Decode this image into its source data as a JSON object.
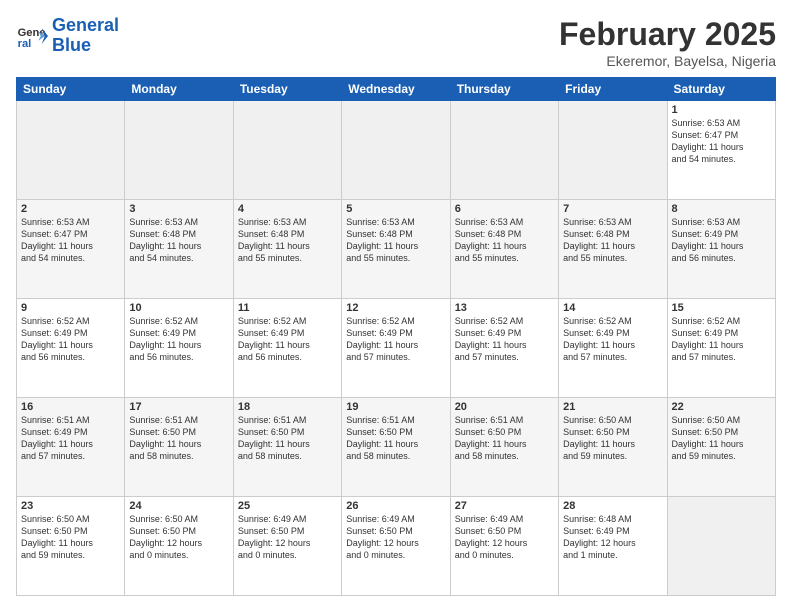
{
  "header": {
    "logo_line1": "General",
    "logo_line2": "Blue",
    "title": "February 2025",
    "subtitle": "Ekeremor, Bayelsa, Nigeria"
  },
  "calendar": {
    "days_of_week": [
      "Sunday",
      "Monday",
      "Tuesday",
      "Wednesday",
      "Thursday",
      "Friday",
      "Saturday"
    ],
    "weeks": [
      [
        {
          "day": "",
          "info": ""
        },
        {
          "day": "",
          "info": ""
        },
        {
          "day": "",
          "info": ""
        },
        {
          "day": "",
          "info": ""
        },
        {
          "day": "",
          "info": ""
        },
        {
          "day": "",
          "info": ""
        },
        {
          "day": "1",
          "info": "Sunrise: 6:53 AM\nSunset: 6:47 PM\nDaylight: 11 hours\nand 54 minutes."
        }
      ],
      [
        {
          "day": "2",
          "info": "Sunrise: 6:53 AM\nSunset: 6:47 PM\nDaylight: 11 hours\nand 54 minutes."
        },
        {
          "day": "3",
          "info": "Sunrise: 6:53 AM\nSunset: 6:48 PM\nDaylight: 11 hours\nand 54 minutes."
        },
        {
          "day": "4",
          "info": "Sunrise: 6:53 AM\nSunset: 6:48 PM\nDaylight: 11 hours\nand 55 minutes."
        },
        {
          "day": "5",
          "info": "Sunrise: 6:53 AM\nSunset: 6:48 PM\nDaylight: 11 hours\nand 55 minutes."
        },
        {
          "day": "6",
          "info": "Sunrise: 6:53 AM\nSunset: 6:48 PM\nDaylight: 11 hours\nand 55 minutes."
        },
        {
          "day": "7",
          "info": "Sunrise: 6:53 AM\nSunset: 6:48 PM\nDaylight: 11 hours\nand 55 minutes."
        },
        {
          "day": "8",
          "info": "Sunrise: 6:53 AM\nSunset: 6:49 PM\nDaylight: 11 hours\nand 56 minutes."
        }
      ],
      [
        {
          "day": "9",
          "info": "Sunrise: 6:52 AM\nSunset: 6:49 PM\nDaylight: 11 hours\nand 56 minutes."
        },
        {
          "day": "10",
          "info": "Sunrise: 6:52 AM\nSunset: 6:49 PM\nDaylight: 11 hours\nand 56 minutes."
        },
        {
          "day": "11",
          "info": "Sunrise: 6:52 AM\nSunset: 6:49 PM\nDaylight: 11 hours\nand 56 minutes."
        },
        {
          "day": "12",
          "info": "Sunrise: 6:52 AM\nSunset: 6:49 PM\nDaylight: 11 hours\nand 57 minutes."
        },
        {
          "day": "13",
          "info": "Sunrise: 6:52 AM\nSunset: 6:49 PM\nDaylight: 11 hours\nand 57 minutes."
        },
        {
          "day": "14",
          "info": "Sunrise: 6:52 AM\nSunset: 6:49 PM\nDaylight: 11 hours\nand 57 minutes."
        },
        {
          "day": "15",
          "info": "Sunrise: 6:52 AM\nSunset: 6:49 PM\nDaylight: 11 hours\nand 57 minutes."
        }
      ],
      [
        {
          "day": "16",
          "info": "Sunrise: 6:51 AM\nSunset: 6:49 PM\nDaylight: 11 hours\nand 57 minutes."
        },
        {
          "day": "17",
          "info": "Sunrise: 6:51 AM\nSunset: 6:50 PM\nDaylight: 11 hours\nand 58 minutes."
        },
        {
          "day": "18",
          "info": "Sunrise: 6:51 AM\nSunset: 6:50 PM\nDaylight: 11 hours\nand 58 minutes."
        },
        {
          "day": "19",
          "info": "Sunrise: 6:51 AM\nSunset: 6:50 PM\nDaylight: 11 hours\nand 58 minutes."
        },
        {
          "day": "20",
          "info": "Sunrise: 6:51 AM\nSunset: 6:50 PM\nDaylight: 11 hours\nand 58 minutes."
        },
        {
          "day": "21",
          "info": "Sunrise: 6:50 AM\nSunset: 6:50 PM\nDaylight: 11 hours\nand 59 minutes."
        },
        {
          "day": "22",
          "info": "Sunrise: 6:50 AM\nSunset: 6:50 PM\nDaylight: 11 hours\nand 59 minutes."
        }
      ],
      [
        {
          "day": "23",
          "info": "Sunrise: 6:50 AM\nSunset: 6:50 PM\nDaylight: 11 hours\nand 59 minutes."
        },
        {
          "day": "24",
          "info": "Sunrise: 6:50 AM\nSunset: 6:50 PM\nDaylight: 12 hours\nand 0 minutes."
        },
        {
          "day": "25",
          "info": "Sunrise: 6:49 AM\nSunset: 6:50 PM\nDaylight: 12 hours\nand 0 minutes."
        },
        {
          "day": "26",
          "info": "Sunrise: 6:49 AM\nSunset: 6:50 PM\nDaylight: 12 hours\nand 0 minutes."
        },
        {
          "day": "27",
          "info": "Sunrise: 6:49 AM\nSunset: 6:50 PM\nDaylight: 12 hours\nand 0 minutes."
        },
        {
          "day": "28",
          "info": "Sunrise: 6:48 AM\nSunset: 6:49 PM\nDaylight: 12 hours\nand 1 minute."
        },
        {
          "day": "",
          "info": ""
        }
      ]
    ]
  }
}
